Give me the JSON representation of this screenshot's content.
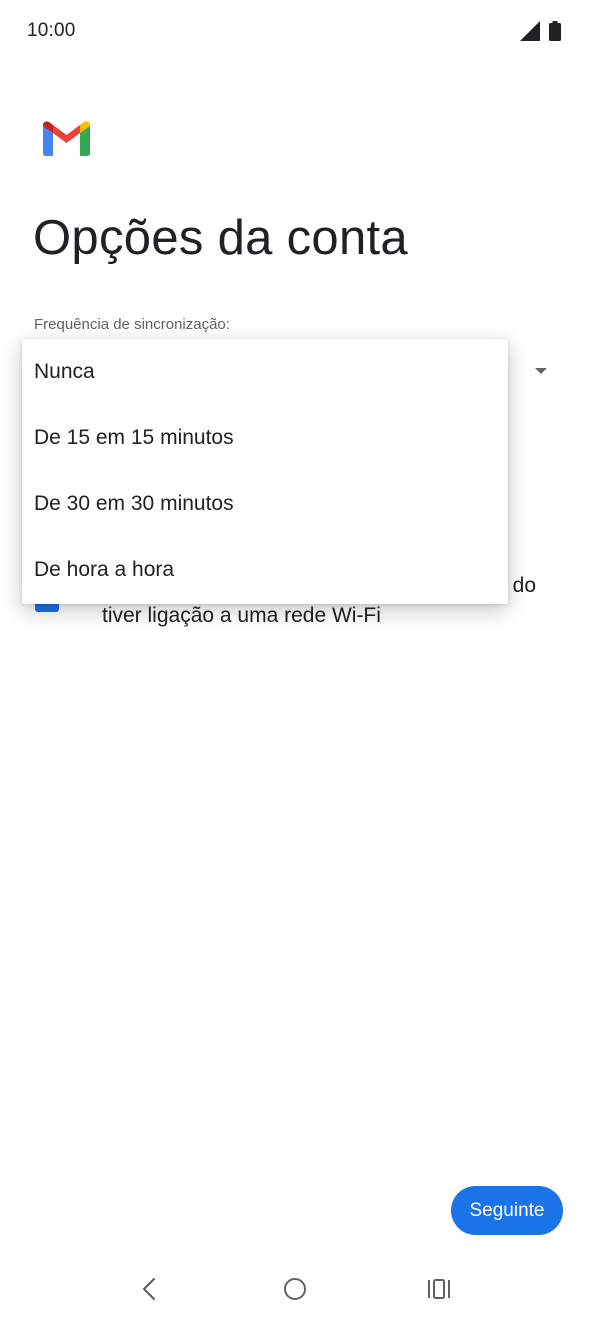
{
  "status_bar": {
    "time": "10:00",
    "icons": [
      "signal-icon",
      "battery-icon"
    ]
  },
  "app": {
    "logo": "gmail-logo-icon"
  },
  "page": {
    "title": "Opções da conta"
  },
  "sync": {
    "label": "Frequência de sincronização:",
    "options": [
      "Nunca",
      "De 15 em 15 minutos",
      "De 30 em 30 minutos",
      "De hora a hora"
    ]
  },
  "wifi_option": {
    "checked": true,
    "text_line1": "do",
    "text_line2": "tiver ligação a uma rede Wi-Fi"
  },
  "footer": {
    "next_label": "Seguinte"
  },
  "nav": {
    "icons": [
      "back-icon",
      "home-icon",
      "recents-icon"
    ]
  },
  "colors": {
    "accent": "#1a73e8",
    "gmail_red": "#ea4335",
    "gmail_blue": "#4285f4",
    "gmail_green": "#34a853",
    "gmail_yellow": "#fbbc04"
  }
}
